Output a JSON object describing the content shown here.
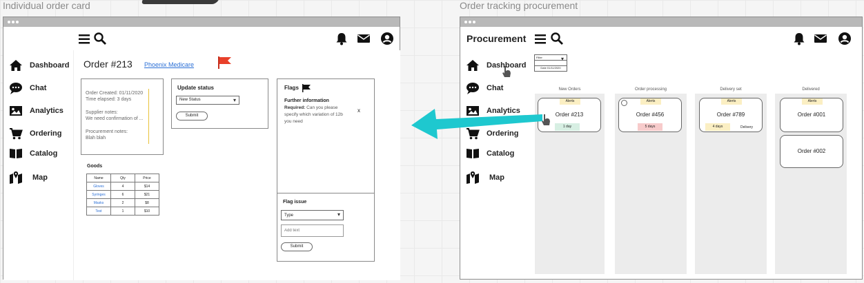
{
  "canvas": {
    "left_label": "Individual order card",
    "right_label": "Order tracking procurement"
  },
  "nav": {
    "items": [
      {
        "label": "Dashboard",
        "icon": "home-icon"
      },
      {
        "label": "Chat",
        "icon": "chat-icon"
      },
      {
        "label": "Analytics",
        "icon": "image-icon"
      },
      {
        "label": "Ordering",
        "icon": "cart-icon"
      },
      {
        "label": "Catalog",
        "icon": "book-icon"
      },
      {
        "label": "Map",
        "icon": "map-icon"
      }
    ]
  },
  "order": {
    "title": "Order #213",
    "customer_link": "Phoenix Medicare",
    "flag_color": "#e8402a",
    "created": "Order Created: 01/11/2020",
    "elapsed": "Time elapsed: 3 days",
    "supplier_notes_label": "Supplier notes:",
    "supplier_notes": "We need confirmation of ...",
    "procurement_notes_label": "Procurement notes:",
    "procurement_notes": "Blah blah"
  },
  "update_status": {
    "title": "Update status",
    "select_value": "New Status",
    "submit_label": "Submit"
  },
  "flags": {
    "title": "Flags",
    "heading": "Further information",
    "required_label": "Required:",
    "body": "Can you please specify which variation of 12b you need",
    "close_label": "x"
  },
  "flag_issue": {
    "title": "Flag issue",
    "type_value": "Type",
    "text_placeholder": "Add text",
    "submit_label": "Submit"
  },
  "goods": {
    "title": "Goods",
    "headers": [
      "Name",
      "Qty",
      "Price"
    ],
    "rows": [
      [
        "Gloves",
        "4",
        "$14"
      ],
      [
        "Syringes",
        "6",
        "$21"
      ],
      [
        "Masks",
        "2",
        "$8"
      ],
      [
        "Test",
        "1",
        "$10"
      ]
    ]
  },
  "procurement": {
    "title": "Procurement",
    "filter": {
      "select_value": "Filter",
      "field": "",
      "date_value": "Date 01/11/2020"
    },
    "columns": [
      {
        "title": "New Orders"
      },
      {
        "title": "Order processing"
      },
      {
        "title": "Delivery set"
      },
      {
        "title": "Delivered"
      }
    ],
    "cards": {
      "o213": {
        "top_tag": "Alerts",
        "label": "Order #213",
        "tag": "1 day"
      },
      "o456": {
        "top_tag": "Alerts",
        "label": "Order #456",
        "tag": "5 days"
      },
      "o789": {
        "top_tag": "Alerts",
        "label": "Order #789",
        "tag": "4 days",
        "extra": "Delivery"
      },
      "o001": {
        "top_tag": "Alerts",
        "label": "Order #001"
      },
      "o002": {
        "label": "Order #002"
      }
    }
  },
  "colors": {
    "arrow": "#1ec8cf",
    "tag_green": "#d7efe3",
    "tag_red": "#f7cbcb",
    "tag_yellow": "#fbefc3"
  }
}
